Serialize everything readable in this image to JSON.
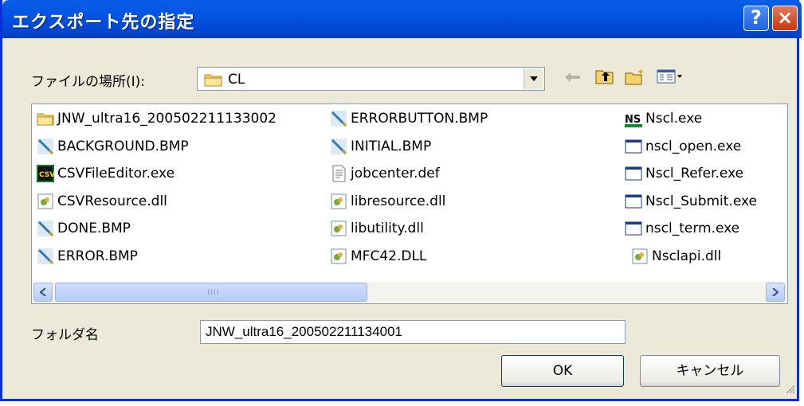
{
  "window": {
    "title": "エクスポート先の指定",
    "help_label": "?",
    "close_label": "×"
  },
  "location": {
    "label": "ファイルの場所(I):",
    "selected": "CL"
  },
  "files": [
    {
      "name": "JNW_ultra16_200502211133002",
      "icon": "folder-icon"
    },
    {
      "name": "BACKGROUND.BMP",
      "icon": "bitmap-icon"
    },
    {
      "name": "CSVFileEditor.exe",
      "icon": "csv-app-icon"
    },
    {
      "name": "CSVResource.dll",
      "icon": "dll-icon"
    },
    {
      "name": "DONE.BMP",
      "icon": "bitmap-icon"
    },
    {
      "name": "ERROR.BMP",
      "icon": "bitmap-icon"
    },
    {
      "name": "ERRORBUTTON.BMP",
      "icon": "bitmap-icon"
    },
    {
      "name": "INITIAL.BMP",
      "icon": "bitmap-icon"
    },
    {
      "name": "jobcenter.def",
      "icon": "text-file-icon"
    },
    {
      "name": "libresource.dll",
      "icon": "dll-icon"
    },
    {
      "name": "libutility.dll",
      "icon": "dll-icon"
    },
    {
      "name": "MFC42.DLL",
      "icon": "dll-icon"
    },
    {
      "name": "Nscl.exe",
      "icon": "ns-app-icon"
    },
    {
      "name": "nscl_open.exe",
      "icon": "window-exe-icon"
    },
    {
      "name": "Nscl_Refer.exe",
      "icon": "window-exe-icon"
    },
    {
      "name": "Nscl_Submit.exe",
      "icon": "window-exe-icon"
    },
    {
      "name": "nscl_term.exe",
      "icon": "window-exe-icon"
    },
    {
      "name": "Nsclapi.dll",
      "icon": "dll-icon"
    }
  ],
  "folder": {
    "label": "フォルダ名",
    "value": "JNW_ultra16_200502211134001"
  },
  "buttons": {
    "ok": "OK",
    "cancel": "キャンセル"
  },
  "scrollbar": {
    "grip": "IIII"
  },
  "colors": {
    "titlebar": "#0054e3",
    "dialog_bg": "#ece9d8",
    "close": "#c4380f"
  }
}
